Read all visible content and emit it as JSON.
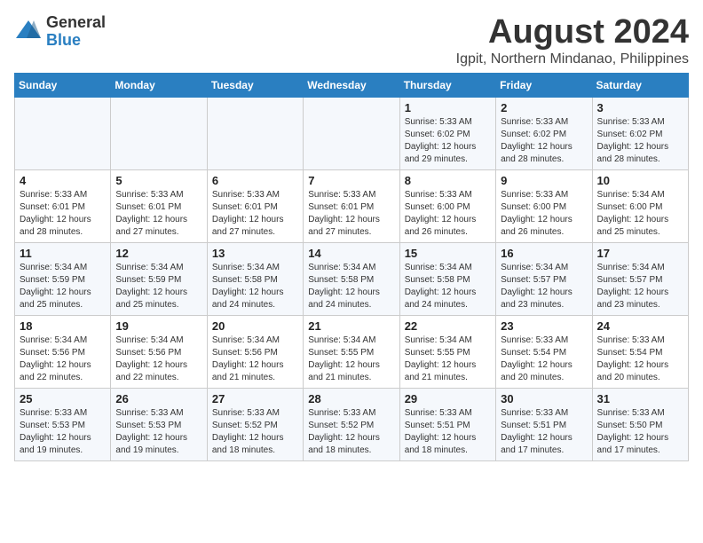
{
  "header": {
    "logo_line1": "General",
    "logo_line2": "Blue",
    "title": "August 2024",
    "subtitle": "Igpit, Northern Mindanao, Philippines"
  },
  "days_of_week": [
    "Sunday",
    "Monday",
    "Tuesday",
    "Wednesday",
    "Thursday",
    "Friday",
    "Saturday"
  ],
  "weeks": [
    [
      {
        "day": "",
        "text": ""
      },
      {
        "day": "",
        "text": ""
      },
      {
        "day": "",
        "text": ""
      },
      {
        "day": "",
        "text": ""
      },
      {
        "day": "1",
        "text": "Sunrise: 5:33 AM\nSunset: 6:02 PM\nDaylight: 12 hours\nand 29 minutes."
      },
      {
        "day": "2",
        "text": "Sunrise: 5:33 AM\nSunset: 6:02 PM\nDaylight: 12 hours\nand 28 minutes."
      },
      {
        "day": "3",
        "text": "Sunrise: 5:33 AM\nSunset: 6:02 PM\nDaylight: 12 hours\nand 28 minutes."
      }
    ],
    [
      {
        "day": "4",
        "text": "Sunrise: 5:33 AM\nSunset: 6:01 PM\nDaylight: 12 hours\nand 28 minutes."
      },
      {
        "day": "5",
        "text": "Sunrise: 5:33 AM\nSunset: 6:01 PM\nDaylight: 12 hours\nand 27 minutes."
      },
      {
        "day": "6",
        "text": "Sunrise: 5:33 AM\nSunset: 6:01 PM\nDaylight: 12 hours\nand 27 minutes."
      },
      {
        "day": "7",
        "text": "Sunrise: 5:33 AM\nSunset: 6:01 PM\nDaylight: 12 hours\nand 27 minutes."
      },
      {
        "day": "8",
        "text": "Sunrise: 5:33 AM\nSunset: 6:00 PM\nDaylight: 12 hours\nand 26 minutes."
      },
      {
        "day": "9",
        "text": "Sunrise: 5:33 AM\nSunset: 6:00 PM\nDaylight: 12 hours\nand 26 minutes."
      },
      {
        "day": "10",
        "text": "Sunrise: 5:34 AM\nSunset: 6:00 PM\nDaylight: 12 hours\nand 25 minutes."
      }
    ],
    [
      {
        "day": "11",
        "text": "Sunrise: 5:34 AM\nSunset: 5:59 PM\nDaylight: 12 hours\nand 25 minutes."
      },
      {
        "day": "12",
        "text": "Sunrise: 5:34 AM\nSunset: 5:59 PM\nDaylight: 12 hours\nand 25 minutes."
      },
      {
        "day": "13",
        "text": "Sunrise: 5:34 AM\nSunset: 5:58 PM\nDaylight: 12 hours\nand 24 minutes."
      },
      {
        "day": "14",
        "text": "Sunrise: 5:34 AM\nSunset: 5:58 PM\nDaylight: 12 hours\nand 24 minutes."
      },
      {
        "day": "15",
        "text": "Sunrise: 5:34 AM\nSunset: 5:58 PM\nDaylight: 12 hours\nand 24 minutes."
      },
      {
        "day": "16",
        "text": "Sunrise: 5:34 AM\nSunset: 5:57 PM\nDaylight: 12 hours\nand 23 minutes."
      },
      {
        "day": "17",
        "text": "Sunrise: 5:34 AM\nSunset: 5:57 PM\nDaylight: 12 hours\nand 23 minutes."
      }
    ],
    [
      {
        "day": "18",
        "text": "Sunrise: 5:34 AM\nSunset: 5:56 PM\nDaylight: 12 hours\nand 22 minutes."
      },
      {
        "day": "19",
        "text": "Sunrise: 5:34 AM\nSunset: 5:56 PM\nDaylight: 12 hours\nand 22 minutes."
      },
      {
        "day": "20",
        "text": "Sunrise: 5:34 AM\nSunset: 5:56 PM\nDaylight: 12 hours\nand 21 minutes."
      },
      {
        "day": "21",
        "text": "Sunrise: 5:34 AM\nSunset: 5:55 PM\nDaylight: 12 hours\nand 21 minutes."
      },
      {
        "day": "22",
        "text": "Sunrise: 5:34 AM\nSunset: 5:55 PM\nDaylight: 12 hours\nand 21 minutes."
      },
      {
        "day": "23",
        "text": "Sunrise: 5:33 AM\nSunset: 5:54 PM\nDaylight: 12 hours\nand 20 minutes."
      },
      {
        "day": "24",
        "text": "Sunrise: 5:33 AM\nSunset: 5:54 PM\nDaylight: 12 hours\nand 20 minutes."
      }
    ],
    [
      {
        "day": "25",
        "text": "Sunrise: 5:33 AM\nSunset: 5:53 PM\nDaylight: 12 hours\nand 19 minutes."
      },
      {
        "day": "26",
        "text": "Sunrise: 5:33 AM\nSunset: 5:53 PM\nDaylight: 12 hours\nand 19 minutes."
      },
      {
        "day": "27",
        "text": "Sunrise: 5:33 AM\nSunset: 5:52 PM\nDaylight: 12 hours\nand 18 minutes."
      },
      {
        "day": "28",
        "text": "Sunrise: 5:33 AM\nSunset: 5:52 PM\nDaylight: 12 hours\nand 18 minutes."
      },
      {
        "day": "29",
        "text": "Sunrise: 5:33 AM\nSunset: 5:51 PM\nDaylight: 12 hours\nand 18 minutes."
      },
      {
        "day": "30",
        "text": "Sunrise: 5:33 AM\nSunset: 5:51 PM\nDaylight: 12 hours\nand 17 minutes."
      },
      {
        "day": "31",
        "text": "Sunrise: 5:33 AM\nSunset: 5:50 PM\nDaylight: 12 hours\nand 17 minutes."
      }
    ]
  ]
}
